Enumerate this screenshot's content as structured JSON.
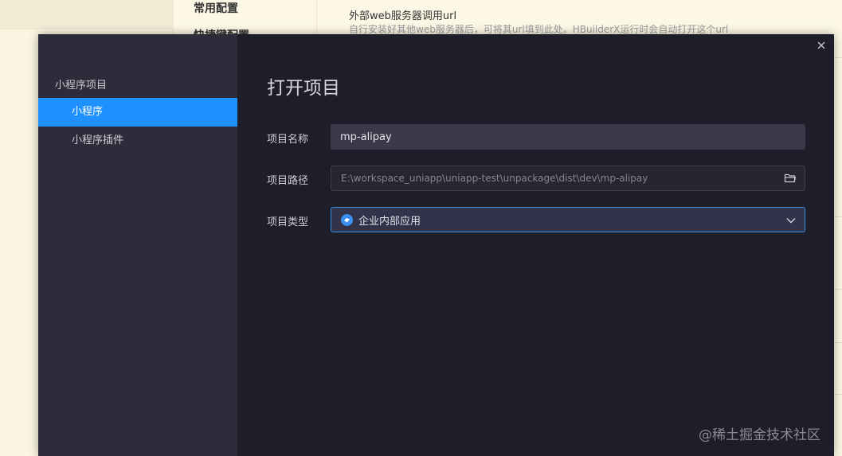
{
  "background": {
    "nav": [
      {
        "label": "常用配置"
      },
      {
        "label": "快捷键配置"
      }
    ],
    "setting_title": "外部web服务器调用url",
    "setting_desc": "自行安装好其他web服务器后，可将其url填到此处。HBuilderX运行时会自动打开这个url"
  },
  "dialog": {
    "close_glyph": "×",
    "sidebar": {
      "category": "小程序项目",
      "items": [
        {
          "label": "小程序",
          "active": true
        },
        {
          "label": "小程序插件",
          "active": false
        }
      ]
    },
    "title": "打开项目",
    "form": {
      "name_label": "项目名称",
      "name_value": "mp-alipay",
      "path_label": "项目路径",
      "path_value": "E:\\workspace_uniapp\\uniapp-test\\unpackage\\dist\\dev\\mp-alipay",
      "type_label": "项目类型",
      "type_value": "企业内部应用"
    }
  },
  "watermark": "@稀土掘金技术社区",
  "colors": {
    "accent": "#1e90ff",
    "dialog_bg": "#1e1e2a",
    "sidebar_bg": "#2c2c3a"
  },
  "icons": [
    "close-icon",
    "folder-icon",
    "alipay-icon",
    "chevron-down-icon"
  ]
}
